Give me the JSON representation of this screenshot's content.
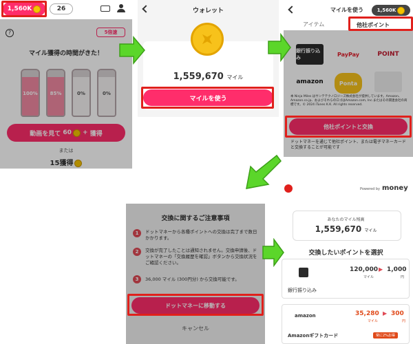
{
  "panel1": {
    "mile_badge": "1,560K",
    "tickets": "26",
    "heading": "マイル獲得の時間がきた！",
    "badge": "5倍速",
    "bottles": [
      {
        "pct": "100%",
        "fill": 1.0
      },
      {
        "pct": "85%",
        "fill": 0.85
      },
      {
        "pct": "0%",
        "fill": 0
      },
      {
        "pct": "0%",
        "fill": 0
      }
    ],
    "watch_label": "動画を見て",
    "watch_num": "60",
    "watch_suffix": "獲得",
    "or": "または",
    "earn": "15獲得"
  },
  "panel2": {
    "title": "ウォレット",
    "balance": "1,559,670",
    "unit": "マイル",
    "use_button": "マイルを使う"
  },
  "panel3": {
    "title": "マイルを使う",
    "badge": "1,560K",
    "tab_items": "アイテム",
    "tab_points": "他社ポイント",
    "logos": [
      {
        "name": "銀行振り込み",
        "bg": "#2b2b2b",
        "color": "#fff"
      },
      {
        "name": "PayPay",
        "bg": "#fff",
        "color": "#e01e2b"
      },
      {
        "name": "POINT",
        "bg": "#fff",
        "color": "#c0172b"
      },
      {
        "name": "amazon",
        "bg": "#fff",
        "color": "#111"
      },
      {
        "name": "Ponta",
        "bg": "#fff",
        "color": "#f0a21d"
      },
      {
        "name": "",
        "bg": "#eee",
        "color": "#999"
      }
    ],
    "fine_print": "本 Ninja Miles はサンテテクノロジーズ株式会社が提供しています。Amazon、Amazon.co.jp、およびそれらのロゴはAmazon.com, Inc.またはその関連会社の商標です。© 2024 iTunes K.K. All rights reserved.",
    "exchange_button": "他社ポイントと交換",
    "footer": "ドットマネーを通じて他社ポイント、または電子マネーカードと交換することが可能です"
  },
  "panel4": {
    "heading": "交換に関するご注意事項",
    "notes": [
      "ドットマネーから各種ポイントへの交換は完了まで数日かかります。",
      "交換が完了したことは通知されません。交換申請後、ドットマネーの「交換履歴を確認」ボタンから交換状況をご確認ください。",
      "36,000 マイル (300円分) から交換可能です。"
    ],
    "go_button": "ドットマネーに移動する",
    "cancel": "キャンセル"
  },
  "panel5": {
    "powered": "Powered by",
    "brand": "money",
    "balance_label": "あなたのマイル残高",
    "balance": "1,559,670",
    "unit": "マイル",
    "select_heading": "交換したいポイントを選択",
    "rows": [
      {
        "name": "銀行振り込み",
        "from": "120,000",
        "from_unit": "マイル",
        "to": "1,000",
        "to_unit": "円",
        "tag": ""
      },
      {
        "name": "Amazonギフトカード",
        "from": "35,280",
        "from_unit": "マイル",
        "to": "300",
        "to_unit": "円",
        "tag": "常に2%お得"
      }
    ]
  },
  "colors": {
    "accent": "#ff2d6b",
    "red_box": "#e0201c",
    "arrow": "#5bd62a"
  }
}
